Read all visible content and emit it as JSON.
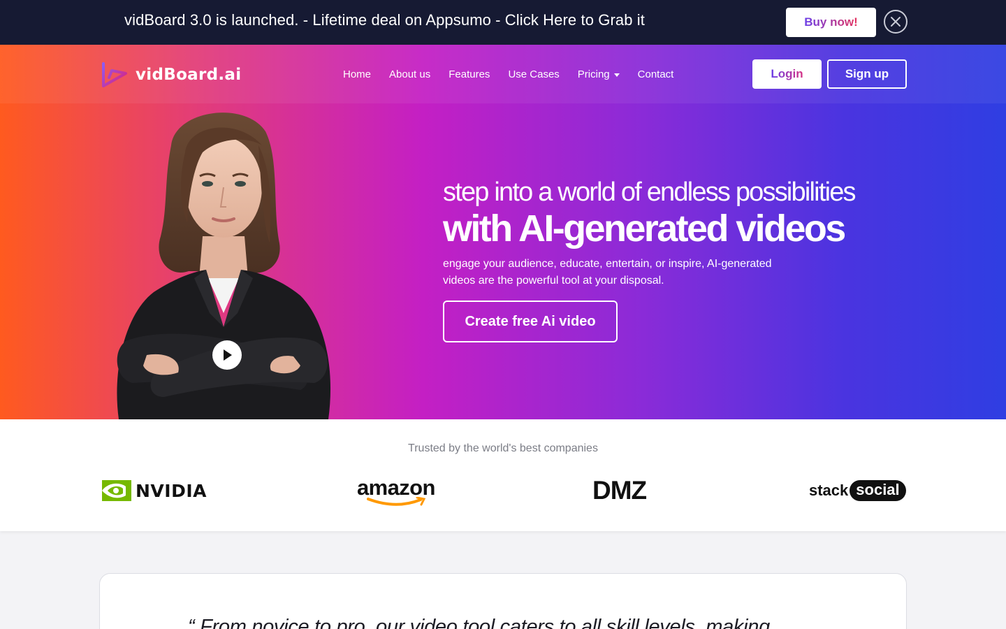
{
  "announcement": {
    "text": "vidBoard 3.0 is launched. - Lifetime deal on Appsumo - Click Here to Grab it",
    "buy_label": "Buy now!",
    "close_icon": "close-circle-icon"
  },
  "header": {
    "logo_text": "vidBoard.ai",
    "logo_icon": "play-v-logo-icon",
    "nav": [
      {
        "label": "Home"
      },
      {
        "label": "About us"
      },
      {
        "label": "Features"
      },
      {
        "label": "Use Cases"
      },
      {
        "label": "Pricing",
        "has_dropdown": true
      },
      {
        "label": "Contact"
      }
    ],
    "login_label": "Login",
    "signup_label": "Sign up"
  },
  "hero": {
    "tagline": "step into a world of endless possibilities",
    "headline": "with AI-generated videos",
    "description": "engage your audience, educate, entertain, or inspire, AI-generated videos are the powerful tool at your disposal.",
    "cta_label": "Create free Ai video",
    "play_icon": "play-icon"
  },
  "trusted": {
    "title": "Trusted by the world's best companies",
    "brands": [
      {
        "name": "NVIDIA",
        "display": "NVIDIA"
      },
      {
        "name": "amazon",
        "display": "amazon"
      },
      {
        "name": "DMZ",
        "display": "DMZ"
      },
      {
        "name": "stacksocial",
        "display_left": "stack",
        "display_right": "social"
      }
    ]
  },
  "testimonial": {
    "quote": "“ From novice to pro, our video tool caters to all skill levels, making"
  },
  "colors": {
    "announce_bg": "#161a33",
    "gradient": [
      "#ff5a1f",
      "#e23c7a",
      "#c41fc4",
      "#8a2bd8",
      "#4a34e0",
      "#2f3ee2"
    ],
    "page_bg": "#f3f3f6"
  }
}
